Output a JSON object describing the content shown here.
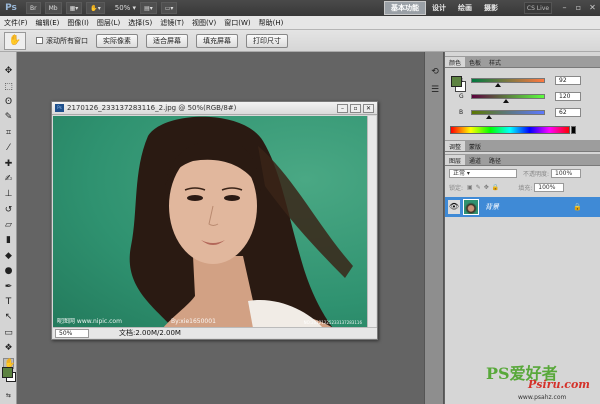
{
  "app": {
    "logo": "Ps",
    "zoom": "50%",
    "workspaces": [
      "基本功能",
      "设计",
      "绘画",
      "摄影"
    ],
    "active_workspace": 0,
    "cs_live": "CS Live",
    "window_controls": [
      "–",
      "▫",
      "✕"
    ]
  },
  "menu": [
    "文件(F)",
    "编辑(E)",
    "图像(I)",
    "图层(L)",
    "选择(S)",
    "滤镜(T)",
    "视图(V)",
    "窗口(W)",
    "帮助(H)"
  ],
  "options_bar": {
    "scroll_all": "滚动所有窗口",
    "buttons": [
      "实际像素",
      "适合屏幕",
      "填充屏幕",
      "打印尺寸"
    ]
  },
  "document": {
    "title": "2170126_233137283116_2.jpg @ 50%(RGB/8#)",
    "zoom": "50%",
    "doc_size": "文档:2.00M/2.00M",
    "watermark_left": "昵图网 www.nipic.com",
    "watermark_mid": "By:xie1650001",
    "watermark_right": "NO:20121225233137283116"
  },
  "color_panel": {
    "tabs": [
      "颜色",
      "色板",
      "样式"
    ],
    "channels": [
      {
        "name": "R",
        "value": "92",
        "fraction": 0.36
      },
      {
        "name": "G",
        "value": "120",
        "fraction": 0.47
      },
      {
        "name": "B",
        "value": "62",
        "fraction": 0.24
      }
    ],
    "foreground": "#5c8240",
    "background": "#ffffff"
  },
  "adjust_panel": {
    "tabs": [
      "调整",
      "蒙版"
    ]
  },
  "layers_panel": {
    "tabs": [
      "图层",
      "通道",
      "路径"
    ],
    "blend_mode": "正常",
    "opacity_label": "不透明度:",
    "opacity": "100%",
    "lock_label": "锁定:",
    "fill_label": "填充:",
    "fill": "100%",
    "layer_name": "背景"
  },
  "site_watermark": {
    "brand": "PS爱好者",
    "sub": "Psiru.com",
    "url": "www.psahz.com"
  }
}
